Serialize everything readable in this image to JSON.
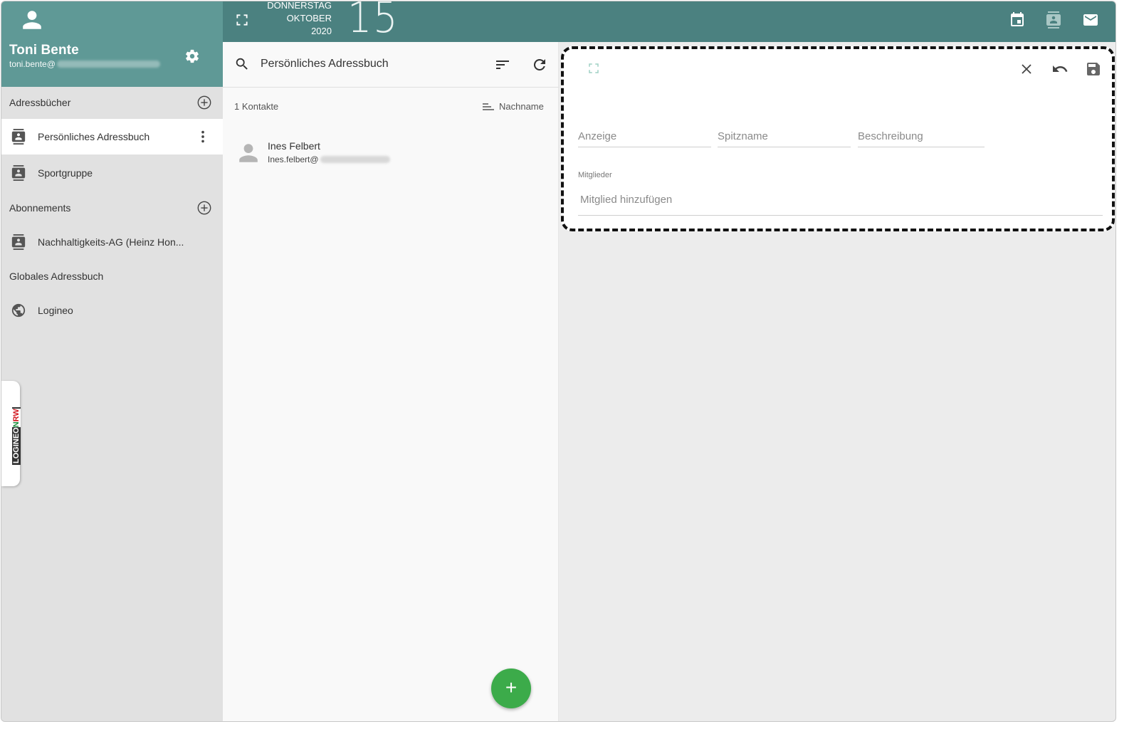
{
  "user": {
    "name": "Toni Bente",
    "email_prefix": "toni.bente@"
  },
  "topbar": {
    "weekday": "DONNERSTAG",
    "month": "OKTOBER",
    "year": "2020",
    "day": "15",
    "icons": [
      "expand-icon",
      "calendar-icon",
      "contacts-icon",
      "mail-icon"
    ]
  },
  "sidebar": {
    "address_books_title": "Adressbücher",
    "address_books": [
      {
        "label": "Persönliches Adressbuch",
        "active": true
      },
      {
        "label": "Sportgruppe",
        "active": false
      }
    ],
    "subscriptions_title": "Abonnements",
    "subscriptions": [
      {
        "label": "Nachhaltigkeits-AG (Heinz Hon..."
      }
    ],
    "global_title": "Globales Adressbuch",
    "global": [
      {
        "label": "Logineo"
      }
    ],
    "brand_tab": {
      "part1": "LOGINEO",
      "part2_n": "N",
      "part2_r": "R",
      "part2_w": "W"
    }
  },
  "list": {
    "search_text": "Persönliches Adressbuch",
    "count": "1 Kontakte",
    "sort_label": "Nachname",
    "contacts": [
      {
        "name": "Ines Felbert",
        "email_prefix": "Ines.felbert@"
      }
    ],
    "fab_label": "+"
  },
  "detail": {
    "field_display_placeholder": "Anzeige",
    "field_nickname_placeholder": "Spitzname",
    "field_description_placeholder": "Beschreibung",
    "members_label": "Mitglieder",
    "member_add_placeholder": "Mitglied hinzufügen"
  },
  "colors": {
    "sidebar_header": "#5f9996",
    "topbar": "#4b8180",
    "fab": "#3cab4a",
    "active_item_bg": "#ffffff"
  }
}
